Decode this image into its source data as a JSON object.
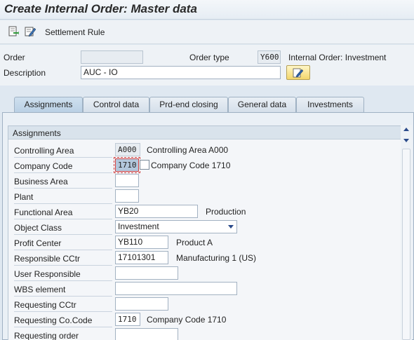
{
  "window": {
    "title": "Create Internal Order: Master data"
  },
  "toolbar": {
    "icons": [
      "execute-icon",
      "edit-icon"
    ],
    "settlement_rule_label": "Settlement Rule"
  },
  "header": {
    "order_label": "Order",
    "order_value": "",
    "order_type_label": "Order type",
    "order_type_value": "Y600",
    "order_type_text": "Internal Order: Investment",
    "description_label": "Description",
    "description_value": "AUC - IO"
  },
  "tabs": [
    {
      "label": "Assignments",
      "active": true
    },
    {
      "label": "Control data",
      "active": false
    },
    {
      "label": "Prd-end closing",
      "active": false
    },
    {
      "label": "General data",
      "active": false
    },
    {
      "label": "Investments",
      "active": false
    }
  ],
  "assignments": {
    "title": "Assignments",
    "controlling_area": {
      "label": "Controlling Area",
      "value": "A000",
      "text": "Controlling Area A000"
    },
    "company_code": {
      "label": "Company Code",
      "value": "1710",
      "text": "Company Code 1710"
    },
    "business_area": {
      "label": "Business Area",
      "value": ""
    },
    "plant": {
      "label": "Plant",
      "value": ""
    },
    "functional_area": {
      "label": "Functional Area",
      "value": "YB20",
      "text": "Production"
    },
    "object_class": {
      "label": "Object Class",
      "value": "Investment"
    },
    "profit_center": {
      "label": "Profit Center",
      "value": "YB110",
      "text": "Product A"
    },
    "responsible_cctr": {
      "label": "Responsible CCtr",
      "value": "17101301",
      "text": "Manufacturing 1 (US)"
    },
    "user_responsible": {
      "label": "User Responsible",
      "value": ""
    },
    "wbs_element": {
      "label": "WBS element",
      "value": ""
    },
    "requesting_cctr": {
      "label": "Requesting CCtr",
      "value": ""
    },
    "requesting_cocode": {
      "label": "Requesting Co.Code",
      "value": "1710",
      "text": "Company Code 1710"
    },
    "requesting_order": {
      "label": "Requesting order",
      "value": ""
    }
  },
  "colors": {
    "accent": "#2a4a8a",
    "focus_border": "#d04040",
    "panel_bg": "#eaf0f6"
  }
}
